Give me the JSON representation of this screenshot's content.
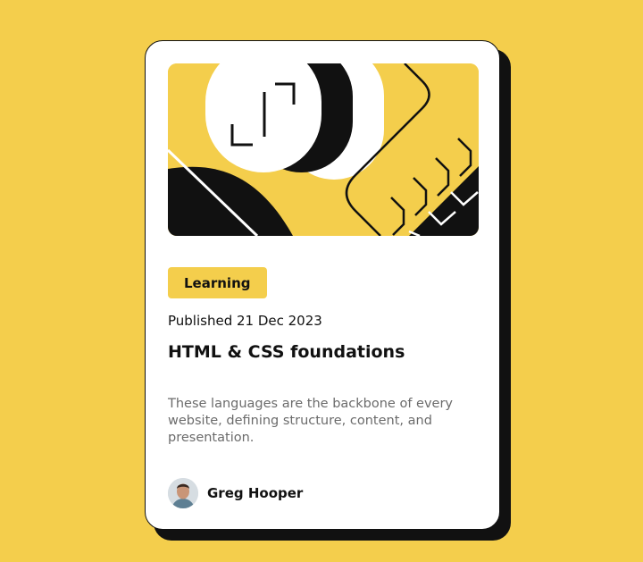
{
  "card": {
    "category": "Learning",
    "published": "Published 21 Dec 2023",
    "title": "HTML & CSS foundations",
    "description": "These languages are the backbone of every website, defining structure, content, and presentation.",
    "author": {
      "name": "Greg Hooper",
      "avatar_icon": "person-avatar"
    },
    "illustration": "abstract-illustration"
  },
  "colors": {
    "background": "#F4CE4C",
    "card": "#FFFFFF",
    "ink": "#111111",
    "muted_text": "#6B6B6B"
  }
}
